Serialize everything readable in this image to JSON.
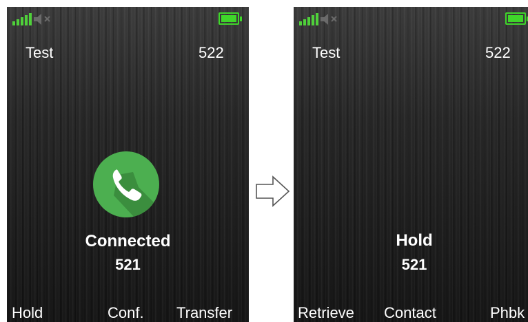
{
  "left_screen": {
    "contact_name": "Test",
    "own_number": "522",
    "call_state": "Connected",
    "peer_number": "521",
    "softkeys": {
      "left": "Hold",
      "center": "Conf.",
      "right": "Transfer"
    },
    "icons": {
      "signal": "signal-bars-icon",
      "mute": "speaker-muted-icon",
      "battery": "battery-full-icon",
      "call": "phone-handset-icon"
    },
    "colors": {
      "accent": "#4caf50",
      "signal": "#4fd13a",
      "battery": "#3fd62a"
    }
  },
  "transition_icon": "right-arrow-icon",
  "right_screen": {
    "contact_name": "Test",
    "own_number": "522",
    "call_state": "Hold",
    "peer_number": "521",
    "softkeys": {
      "left": "Retrieve",
      "center": "Contact",
      "right": "Phbk"
    },
    "icons": {
      "signal": "signal-bars-icon",
      "mute": "speaker-muted-icon",
      "battery": "battery-full-icon"
    }
  }
}
